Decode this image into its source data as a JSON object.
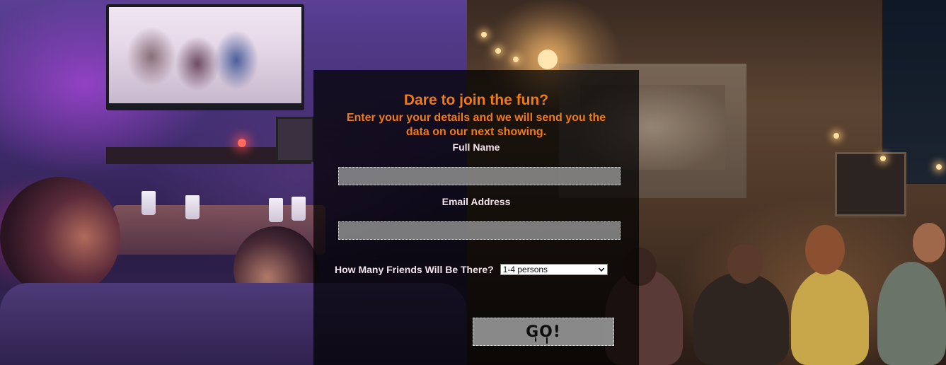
{
  "form": {
    "title": "Dare to join the fun?",
    "subtitle": "Enter your your details and we will send you the data on our next showing.",
    "full_name": {
      "label": "Full Name",
      "value": "",
      "placeholder": ""
    },
    "email": {
      "label": "Email Address",
      "value": "",
      "placeholder": ""
    },
    "friends": {
      "label": "How Many Friends Will Be There?",
      "selected": "1-4 persons"
    },
    "submit_label": "GO!"
  },
  "colors": {
    "accent": "#f07a14",
    "label_text": "#f4e3ea",
    "panel_bg": "rgba(0,0,0,0.72)"
  },
  "icons": {
    "select_arrow": "chevron-down-icon"
  }
}
